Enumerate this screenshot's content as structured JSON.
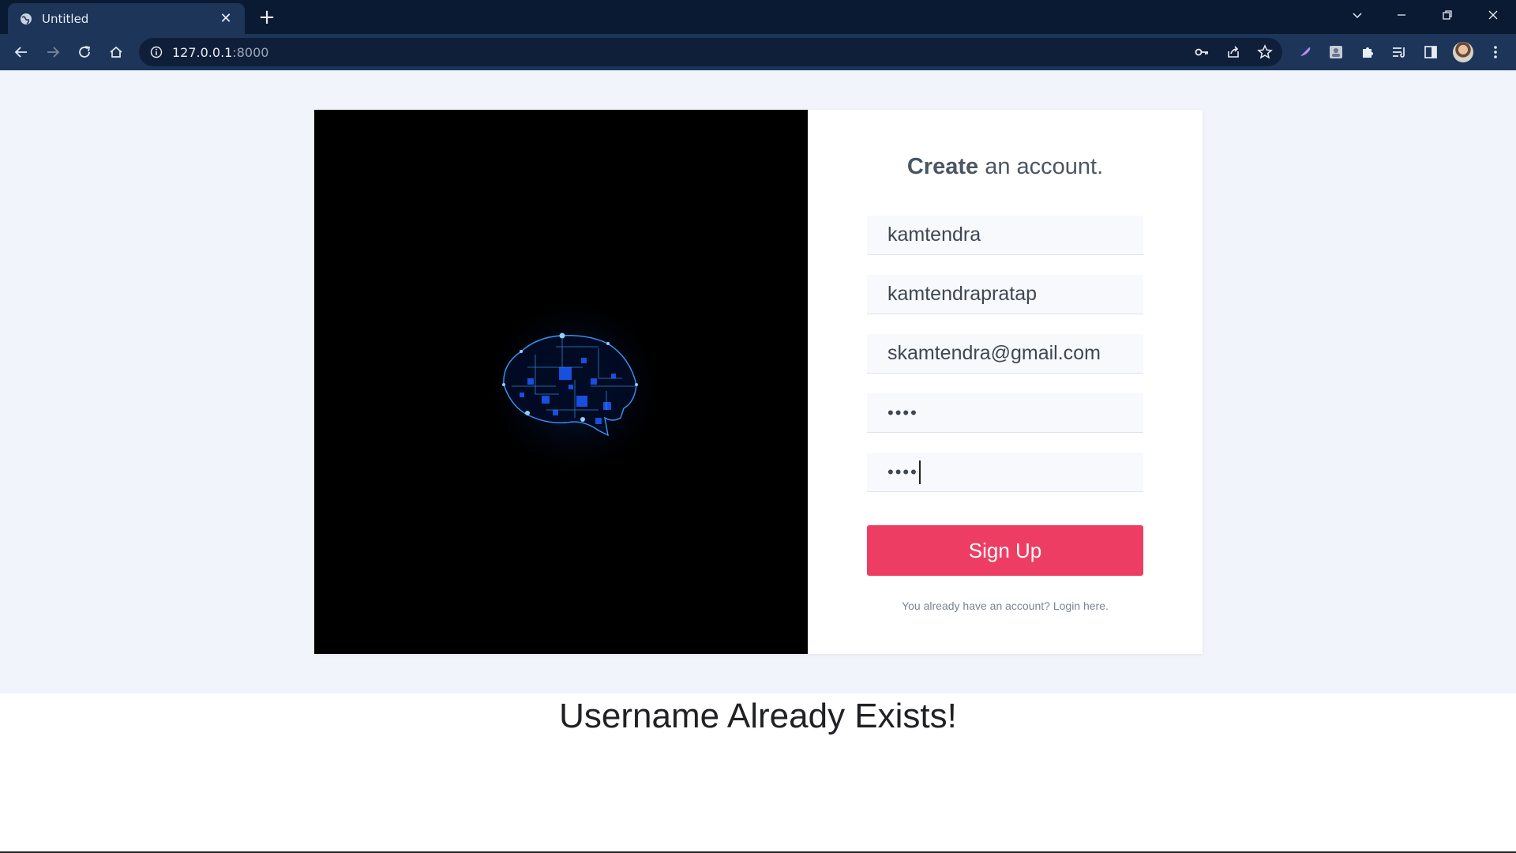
{
  "browser": {
    "tab_title": "Untitled",
    "tab_close": "✕",
    "new_tab": "+",
    "url_host": "127.0.0.1",
    "url_port": ":8000"
  },
  "form": {
    "heading_bold": "Create",
    "heading_rest": " an account.",
    "first_name": "kamtendra",
    "username": "kamtendrapratap",
    "email": "skamtendra@gmail.com",
    "password_mask": "••••",
    "confirm_mask": "••••",
    "signup_label": "Sign Up",
    "login_note": "You already have an account? Login here."
  },
  "message": {
    "error": "Username Already Exists!"
  },
  "colors": {
    "accent": "#ee3d63",
    "chrome_dark": "#0b1a33",
    "chrome_mid": "#1d3559",
    "page_bg": "#f1f5fb"
  },
  "icons": [
    "globe-icon",
    "close-icon",
    "plus-icon",
    "back-icon",
    "forward-icon",
    "reload-icon",
    "home-icon",
    "info-icon",
    "key-icon",
    "share-icon",
    "star-icon",
    "feather-icon",
    "extension-icon",
    "puzzle-icon",
    "reading-list-icon",
    "side-panel-icon",
    "menu-icon"
  ]
}
